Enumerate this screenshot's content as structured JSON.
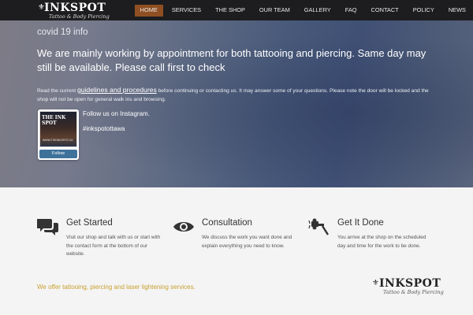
{
  "header": {
    "logo_text": "INKSPOT",
    "logo_subtext": "Tattoo & Body Piercing",
    "nav": [
      "HOME",
      "SERVICES",
      "THE SHOP",
      "OUR TEAM",
      "GALLERY",
      "FAQ",
      "CONTACT",
      "POLICY",
      "NEWS"
    ],
    "active_nav": "HOME",
    "active_color": "#8f4f22"
  },
  "hero": {
    "title": "covid 19 info",
    "lead": "We are mainly working by appointment for both tattooing and piercing. Same day may still be available. Please call first to check",
    "body_pre": "Read the current ",
    "body_link": "guidelines and procedures",
    "body_post": " before continuing or contacting us. It may answer some of your questions. Please note the door will be locked and the shop will not be open for general walk ins and browsing.",
    "instagram": {
      "photo_title": "THE INK SPOT",
      "photo_caption": "WWW.THEINKSPOT.CA",
      "follow_label": "Follow",
      "follow_text": "Follow us on Instagram.",
      "hashtag": "#inkspotottawa"
    }
  },
  "features": [
    {
      "icon": "chat-bubbles-icon",
      "title": "Get Started",
      "desc": "Visit our shop and talk with us or start with the contact form at the bottom of our website."
    },
    {
      "icon": "eye-icon",
      "title": "Consultation",
      "desc": "We discuss the work you want done and explain everything you need to know."
    },
    {
      "icon": "tattoo-machine-icon",
      "title": "Get It Done",
      "desc": "You arrive at the shop on the scheduled day and time for the work to be done."
    }
  ],
  "footer_note": "We offer tattooing, piercing and laser lightening services.",
  "footer_note_color": "#c8a02e",
  "footer_logo_text": "INKSPOT",
  "footer_logo_subtext": "Tattoo & Body Piercing"
}
